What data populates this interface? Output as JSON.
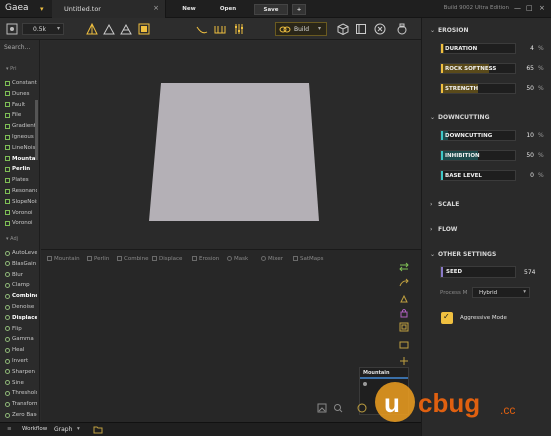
{
  "titlebar": {
    "app_name": "Gaea",
    "app_caret": "▾",
    "document_title": "Untitled.tor",
    "close_glyph": "×",
    "buttons": {
      "new": "New",
      "open": "Open",
      "save": "Save",
      "add": "+"
    },
    "build_info": "Build 9002 Ultra Edition",
    "window_controls": {
      "minimize": "—",
      "maximize": "□",
      "close": "×"
    }
  },
  "toolbar": {
    "resolution": "0.5k",
    "resolution_caret": "▾",
    "build_label": "Build",
    "build_caret": "▾"
  },
  "left_panel": {
    "search_placeholder": "Search...",
    "group_primitives": "Pri",
    "primitives": [
      {
        "label": "Constant",
        "bold": false
      },
      {
        "label": "Dunes",
        "bold": false
      },
      {
        "label": "Fault",
        "bold": false
      },
      {
        "label": "File",
        "bold": false
      },
      {
        "label": "Gradient",
        "bold": false
      },
      {
        "label": "Igneous",
        "bold": false
      },
      {
        "label": "LineNoise",
        "bold": false
      },
      {
        "label": "Mountain",
        "bold": true
      },
      {
        "label": "Perlin",
        "bold": true
      },
      {
        "label": "Plates",
        "bold": false
      },
      {
        "label": "Resonance",
        "bold": false
      },
      {
        "label": "SlopeNoise",
        "bold": false
      },
      {
        "label": "Voronoi",
        "bold": false
      },
      {
        "label": "Voronoi",
        "bold": false
      }
    ],
    "group_adjustments": "Adj",
    "adjustments": [
      {
        "label": "AutoLevel",
        "bold": false
      },
      {
        "label": "BlasGain",
        "bold": false
      },
      {
        "label": "Blur",
        "bold": false
      },
      {
        "label": "Clamp",
        "bold": false
      },
      {
        "label": "Combine",
        "bold": true
      },
      {
        "label": "Denoise",
        "bold": false
      },
      {
        "label": "Displace",
        "bold": true
      },
      {
        "label": "Flip",
        "bold": false
      },
      {
        "label": "Gamma",
        "bold": false
      },
      {
        "label": "Heal",
        "bold": false
      },
      {
        "label": "Invert",
        "bold": false
      },
      {
        "label": "Sharpen",
        "bold": false
      },
      {
        "label": "Sine",
        "bold": false
      },
      {
        "label": "Threshold",
        "bold": false
      },
      {
        "label": "Transform",
        "bold": false
      },
      {
        "label": "Zero Base",
        "bold": false
      }
    ]
  },
  "graph": {
    "legend": [
      "Mountain",
      "Perlin",
      "Combine",
      "Displace",
      "Erosion",
      "Mask",
      "Mixer",
      "SatMaps"
    ],
    "node_card_title": "Mountain"
  },
  "bottom_bar": {
    "workflow_label": "Workflow",
    "view_label": "Graph",
    "view_caret": "▾"
  },
  "right_panel": {
    "erosion": {
      "title": "EROSION",
      "chevron": "⌄",
      "params": [
        {
          "label": "DURATION",
          "value": "4",
          "unit": "%",
          "fraction": 0.04
        },
        {
          "label": "ROCK SOFTNESS",
          "value": "65",
          "unit": "%",
          "fraction": 0.65
        },
        {
          "label": "STRENGTH",
          "value": "50",
          "unit": "%",
          "fraction": 0.5
        }
      ]
    },
    "downcutting": {
      "title": "DOWNCUTTING",
      "chevron": "⌄",
      "params": [
        {
          "label": "DOWNCUTTING",
          "value": "10",
          "unit": "%",
          "fraction": 0.1
        },
        {
          "label": "INHIBITION",
          "value": "50",
          "unit": "%",
          "fraction": 0.5
        },
        {
          "label": "BASE LEVEL",
          "value": "0",
          "unit": "%",
          "fraction": 0.0
        }
      ]
    },
    "scale_title": "SCALE",
    "flow_title": "FLOW",
    "collapsed_chevron": "›",
    "other_settings": {
      "title": "OTHER SETTINGS",
      "chevron": "⌄",
      "seed_label": "SEED",
      "seed_value": "574",
      "process_mode_label": "Process M",
      "process_mode_value": "Hybrid",
      "process_mode_caret": "▾",
      "aggressive_mode_label": "Aggressive Mode",
      "aggressive_mode_checked": true,
      "check_glyph": "✓"
    }
  },
  "colors": {
    "accent_gold": "#f0c040",
    "accent_teal": "#3ec8c8",
    "seed_purple": "#8a7ac8",
    "node_green": "#7fbf56"
  }
}
